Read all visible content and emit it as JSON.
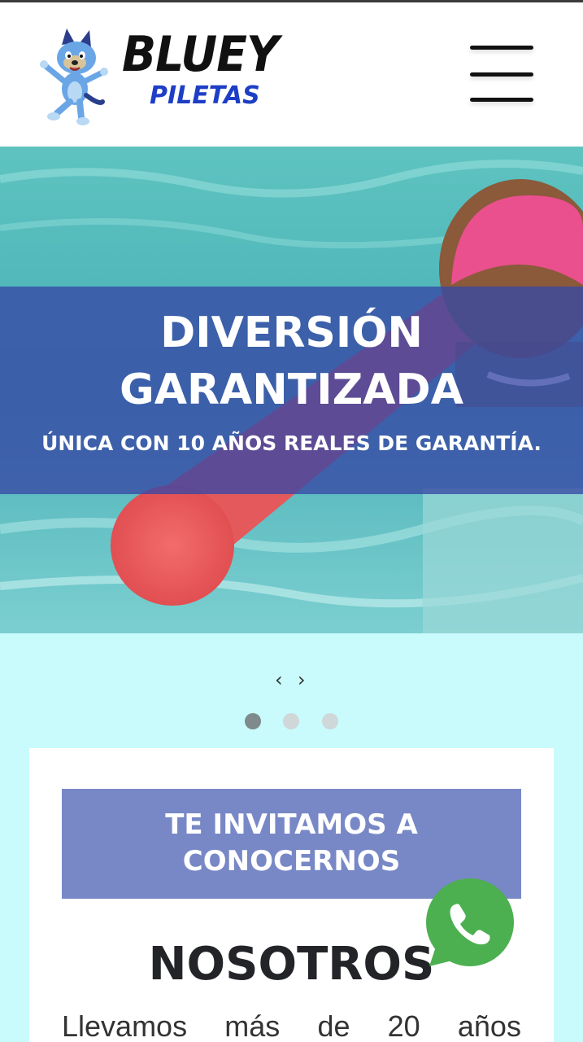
{
  "header": {
    "logo_title": "BLUEY",
    "logo_subtitle": "PILETAS",
    "menu_icon": "hamburger-icon"
  },
  "hero": {
    "title_line1": "DIVERSIÓN",
    "title_line2": "GARANTIZADA",
    "subtitle": "ÚNICA CON 10 AÑOS REALES DE GARANTÍA.",
    "band_color": "#3748a5"
  },
  "slider": {
    "prev": "‹",
    "next": "›",
    "dot_count": 3,
    "active_dot": 0
  },
  "invite": {
    "line1": "TE INVITAMOS A",
    "line2": "CONOCERNOS"
  },
  "about": {
    "title": "NOSOTROS",
    "text_words": [
      "Llevamos",
      "más",
      "de",
      "20",
      "años"
    ]
  },
  "colors": {
    "page_bg": "#c9fbfd",
    "invite_bg": "#7888c6",
    "whatsapp": "#4caf50",
    "logo_sub": "#1d3ec5"
  },
  "floating": {
    "whatsapp_icon": "whatsapp-icon"
  }
}
